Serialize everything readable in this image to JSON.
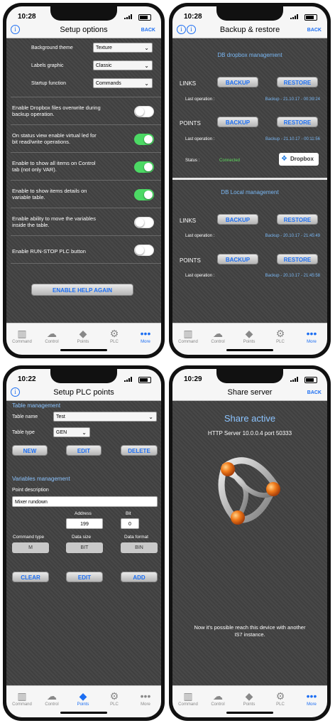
{
  "status_times": [
    "10:28",
    "10:28",
    "10:22",
    "10:29"
  ],
  "tabs": [
    "Command",
    "Control",
    "Points",
    "PLC",
    "More"
  ],
  "setup": {
    "title": "Setup options",
    "back": "BACK",
    "bg_label": "Background theme",
    "bg_value": "Texture",
    "labels_label": "Labels graphic",
    "labels_value": "Classic",
    "startup_label": "Startup function",
    "startup_value": "Commands",
    "options": [
      {
        "text": "Enable Dropbox files overwrite during backup operation.",
        "on": false
      },
      {
        "text": "On status view enable virtual led for bit read/write operations.",
        "on": true
      },
      {
        "text": "Enable to show all items on Control tab (not only VAR).",
        "on": true
      },
      {
        "text": "Enable to show items details on variable table.",
        "on": true
      },
      {
        "text": "Enable ability to move the variables inside the table.",
        "on": false
      },
      {
        "text": "Enable RUN-STOP PLC button",
        "on": false
      }
    ],
    "help_button": "ENABLE HELP AGAIN"
  },
  "backup": {
    "title": "Backup & restore",
    "back": "BACK",
    "dropbox_header": "DB dropbox management",
    "local_header": "DB Local management",
    "links": "LINKS",
    "points": "POINTS",
    "backup_btn": "BACKUP",
    "restore_btn": "RESTORE",
    "last_op": "Last operation :",
    "dropbox_links_last": "Backup - 21.10.17 - 00:39:24",
    "dropbox_points_last": "Backup - 21.10.17 - 00:11:56",
    "status_label": "Status :",
    "status_value": "Connected",
    "dropbox_logo": "Dropbox",
    "local_links_last": "Backup - 20.10.17 - 21:45:49",
    "local_points_last": "Backup - 20.10.17 - 21:45:58"
  },
  "plc": {
    "title": "Setup PLC points",
    "table_header": "Table management",
    "table_name_label": "Table name",
    "table_name_value": "Test",
    "table_type_label": "Table type",
    "table_type_value": "GEN",
    "new_btn": "NEW",
    "edit_btn": "EDIT",
    "delete_btn": "DELETE",
    "var_header": "Variables management",
    "point_desc_label": "Point description",
    "point_desc_value": "Mixer rundown",
    "address_label": "Address",
    "address_value": "199",
    "bit_label": "Bit",
    "bit_value": "0",
    "cmd_type_label": "Command type",
    "cmd_type_value": "M",
    "data_size_label": "Data size",
    "data_size_value": "BIT",
    "data_format_label": "Data format",
    "data_format_value": "BIN",
    "clear_btn": "CLEAR",
    "edit2_btn": "EDIT",
    "add_btn": "ADD"
  },
  "share": {
    "title": "Share server",
    "back": "BACK",
    "active": "Share active",
    "server": "HTTP Server 10.0.0.4 port 50333",
    "message": "Now it's possible reach this device with another IS7 instance."
  },
  "colors": {
    "accent": "#1c6ef2",
    "switch_on": "#4cd964",
    "connected": "#5fdc5f"
  }
}
